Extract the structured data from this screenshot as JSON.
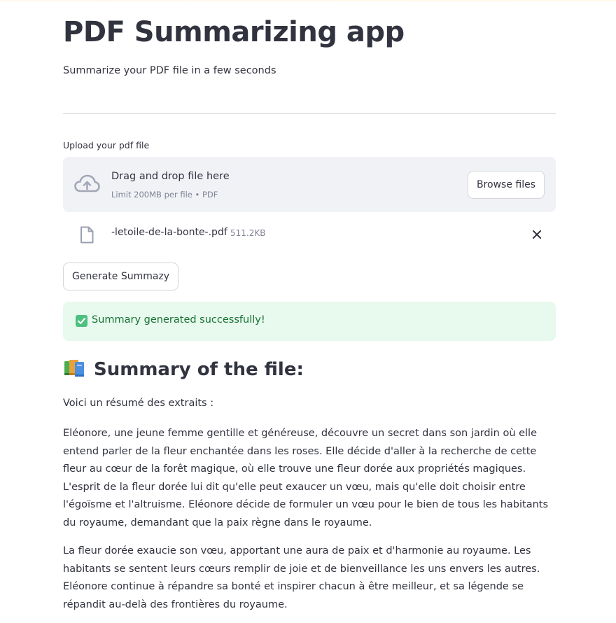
{
  "app": {
    "title": "PDF Summarizing app",
    "subtitle": "Summarize your PDF file in a few seconds"
  },
  "uploader": {
    "label": "Upload your pdf file",
    "drop_text": "Drag and drop file here",
    "limit_text": "Limit 200MB per file • PDF",
    "browse_label": "Browse files",
    "icon": "cloud-upload-icon"
  },
  "uploaded_file": {
    "name": "-letoile-de-la-bonte-.pdf",
    "size": "511.2KB",
    "icon": "file-icon",
    "remove_icon": "close-icon"
  },
  "actions": {
    "generate_label": "Generate Summazy"
  },
  "alert": {
    "type": "success",
    "icon": "check-box-icon",
    "message": "Summary generated successfully!"
  },
  "summary": {
    "heading": "Summary of the file:",
    "heading_icon": "books-icon",
    "intro": "Voici un résumé des extraits :",
    "paragraphs": [
      "Eléonore, une jeune femme gentille et généreuse, découvre un secret dans son jardin où elle entend parler de la fleur enchantée dans les roses. Elle décide d'aller à la recherche de cette fleur au cœur de la forêt magique, où elle trouve une fleur dorée aux propriétés magiques. L'esprit de la fleur dorée lui dit qu'elle peut exaucer un vœu, mais qu'elle doit choisir entre l'égoïsme et l'altruisme. Eléonore décide de formuler un vœu pour le bien de tous les habitants du royaume, demandant que la paix règne dans le royaume.",
      "La fleur dorée exaucie son vœu, apportant une aura de paix et d'harmonie au royaume. Les habitants se sentent leurs cœurs remplir de joie et de bienveillance les uns envers les autres. Eléonore continue à répandre sa bonté et inspirer chacun à être meilleur, et sa légende se répandit au-delà des frontières du royaume."
    ]
  },
  "colors": {
    "text": "#31333f",
    "muted": "#808495",
    "dropzone_bg": "#f0f2f6",
    "success_bg": "#e8f9ee",
    "success_text": "#177233",
    "border": "#d5d6d9"
  }
}
